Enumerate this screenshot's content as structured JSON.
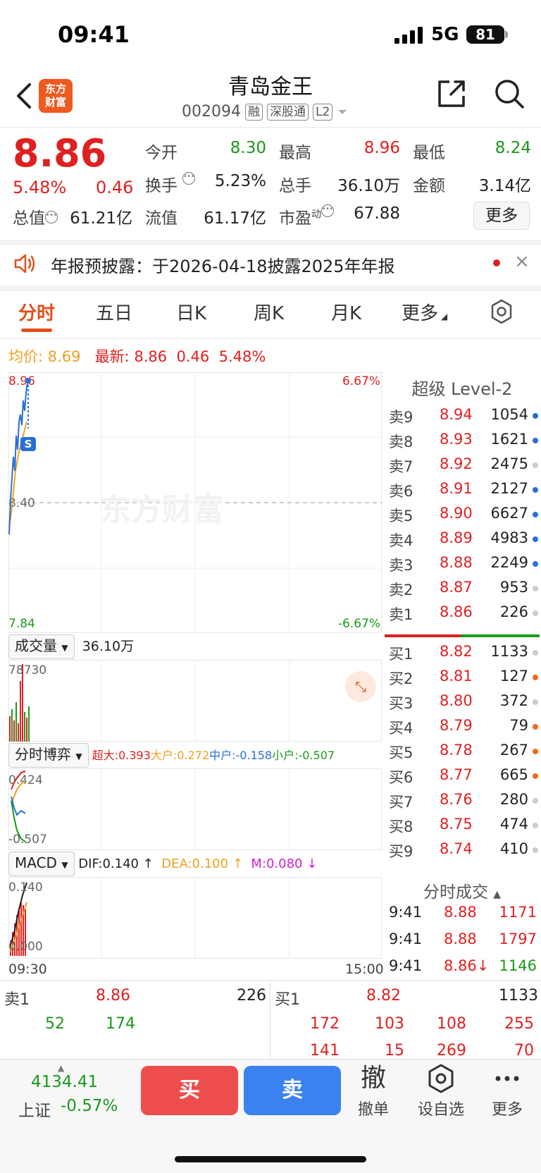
{
  "status": {
    "time": "09:41",
    "network": "5G",
    "battery": "81"
  },
  "header": {
    "logo": "东方\n财富",
    "name": "青岛金王",
    "code": "002094",
    "tags": [
      "融",
      "深股通",
      "L2"
    ]
  },
  "quote": {
    "price": "8.86",
    "pct": "5.48%",
    "change": "0.46",
    "open_label": "今开",
    "open": "8.30",
    "high_label": "最高",
    "high": "8.96",
    "low_label": "最低",
    "low": "8.24",
    "turnover_label": "换手",
    "turnover": "5.23%",
    "volume_label": "总手",
    "volume": "36.10万",
    "amount_label": "金额",
    "amount": "3.14亿",
    "mcap_label": "总值",
    "mcap": "61.21亿",
    "float_label": "流值",
    "float": "61.17亿",
    "pe_label": "市盈",
    "pe_sup": "动",
    "pe": "67.88",
    "more": "更多"
  },
  "notice": {
    "text": "年报预披露：于2026-04-18披露2025年年报",
    "close": "×"
  },
  "tabs": {
    "fenshi": "分时",
    "wuri": "五日",
    "rik": "日K",
    "zhouk": "周K",
    "yuek": "月K",
    "more": "更多"
  },
  "avgline": {
    "avg_label": "均价:",
    "avg": "8.69",
    "latest_label": "最新:",
    "latest": "8.86",
    "chg": "0.46",
    "pct": "5.48%"
  },
  "chart": {
    "top_price": "8.96",
    "mid_price": "8.40",
    "bottom_price": "7.84",
    "top_pct": "6.67%",
    "bottom_pct": "-6.67%",
    "watermark": "东方财富",
    "vol_label": "成交量",
    "vol_total": "36.10万",
    "vol_max": "78730",
    "game_label": "分时博弈",
    "game_super_label": "超大:",
    "game_super": "0.393",
    "game_big_label": "大户:",
    "game_big": "0.272",
    "game_mid_label": "中户:",
    "game_mid": "-0.158",
    "game_small_label": "小户:",
    "game_small": "-0.507",
    "game_top": "0.424",
    "game_bottom": "-0.507",
    "macd_label": "MACD",
    "dif": "DIF:0.140 ↑",
    "dea": "DEA:0.100 ↑",
    "m": "M:0.080 ↓",
    "macd_top": "0.140",
    "macd_bottom": "0.000",
    "time_start": "09:30",
    "time_end": "15:00",
    "colors": {
      "price_line": "#2a6fd6",
      "avg_line": "#f0a020",
      "up": "#e02020",
      "down": "#1a9a1a"
    }
  },
  "level2": {
    "title": "超级 Level-2",
    "asks": [
      {
        "label": "卖9",
        "price": "8.94",
        "vol": "1054",
        "dot": "#2a6fd6"
      },
      {
        "label": "卖8",
        "price": "8.93",
        "vol": "1621",
        "dot": "#2a6fd6"
      },
      {
        "label": "卖7",
        "price": "8.92",
        "vol": "2475",
        "dot": "#cccccc"
      },
      {
        "label": "卖6",
        "price": "8.91",
        "vol": "2127",
        "dot": "#2a6fd6"
      },
      {
        "label": "卖5",
        "price": "8.90",
        "vol": "6627",
        "dot": "#2a6fd6"
      },
      {
        "label": "卖4",
        "price": "8.89",
        "vol": "4983",
        "dot": "#2a6fd6"
      },
      {
        "label": "卖3",
        "price": "8.88",
        "vol": "2249",
        "dot": "#2a6fd6"
      },
      {
        "label": "卖2",
        "price": "8.87",
        "vol": "953",
        "dot": "#cccccc"
      },
      {
        "label": "卖1",
        "price": "8.86",
        "vol": "226",
        "dot": "#cccccc"
      }
    ],
    "bids": [
      {
        "label": "买1",
        "price": "8.82",
        "vol": "1133",
        "dot": "#cccccc"
      },
      {
        "label": "买2",
        "price": "8.81",
        "vol": "127",
        "dot": "#ee6a1a"
      },
      {
        "label": "买3",
        "price": "8.80",
        "vol": "372",
        "dot": "#cccccc"
      },
      {
        "label": "买4",
        "price": "8.79",
        "vol": "79",
        "dot": "#ee6a1a"
      },
      {
        "label": "买5",
        "price": "8.78",
        "vol": "267",
        "dot": "#ee6a1a"
      },
      {
        "label": "买6",
        "price": "8.77",
        "vol": "665",
        "dot": "#ee6a1a"
      },
      {
        "label": "买7",
        "price": "8.76",
        "vol": "280",
        "dot": "#cccccc"
      },
      {
        "label": "买8",
        "price": "8.75",
        "vol": "474",
        "dot": "#cccccc"
      },
      {
        "label": "买9",
        "price": "8.74",
        "vol": "410",
        "dot": "#cccccc"
      }
    ],
    "ticks_title": "分时成交",
    "ticks": [
      {
        "time": "9:41",
        "price": "8.88",
        "vol": "1171"
      },
      {
        "time": "9:41",
        "price": "8.88",
        "vol": "1797"
      },
      {
        "time": "9:41",
        "price": "8.86↓",
        "vol": "1146"
      }
    ]
  },
  "bottom_quotes": {
    "sell_label": "卖1",
    "sell_price": "8.86",
    "sell_vol": "226",
    "buy_label": "买1",
    "buy_price": "8.82",
    "buy_vol": "1133",
    "sell_orders": [
      "52",
      "174"
    ],
    "buy_orders_row1": [
      "172",
      "103",
      "108",
      "255"
    ],
    "buy_orders_row2": [
      "141",
      "15",
      "269",
      "70"
    ]
  },
  "nav": {
    "index_value": "4134.41",
    "index_name": "上证",
    "index_pct": "-0.57%",
    "buy": "买",
    "sell": "卖",
    "cancel_icon": "撤",
    "cancel": "撤单",
    "watch": "设自选",
    "more": "更多"
  }
}
